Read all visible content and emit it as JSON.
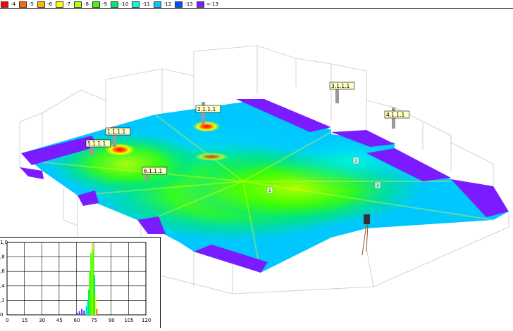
{
  "legend": {
    "items": [
      {
        "label": "-4",
        "color": "#ff0000"
      },
      {
        "label": "-5",
        "color": "#ff6a00"
      },
      {
        "label": "-6",
        "color": "#ffb400"
      },
      {
        "label": "-7",
        "color": "#ffff00"
      },
      {
        "label": "-8",
        "color": "#b4ff00"
      },
      {
        "label": "-9",
        "color": "#3cff00"
      },
      {
        "label": "-10",
        "color": "#00e676"
      },
      {
        "label": "-11",
        "color": "#00ffe0"
      },
      {
        "label": "-12",
        "color": "#00c8ff"
      },
      {
        "label": "-13",
        "color": "#0050ff"
      },
      {
        "label": "<-13",
        "color": "#7a1cff"
      }
    ]
  },
  "access_points": [
    {
      "label": "1.1.1.1"
    },
    {
      "label": "2.1.1.1"
    },
    {
      "label": "3.1.1.1"
    },
    {
      "label": "4.1.1.1"
    },
    {
      "label": "5.1.1.1"
    },
    {
      "label": "6.1.1.1"
    }
  ],
  "markers": [
    {
      "label": "1"
    },
    {
      "label": "2"
    },
    {
      "label": "3"
    }
  ],
  "histogram": {
    "y_ticks": [
      "0",
      ",2",
      ",4",
      ",6",
      ",8",
      "1,0"
    ],
    "x_ticks": [
      "0",
      "15",
      "30",
      "45",
      "60",
      "75",
      "90",
      "105",
      "120"
    ]
  }
}
